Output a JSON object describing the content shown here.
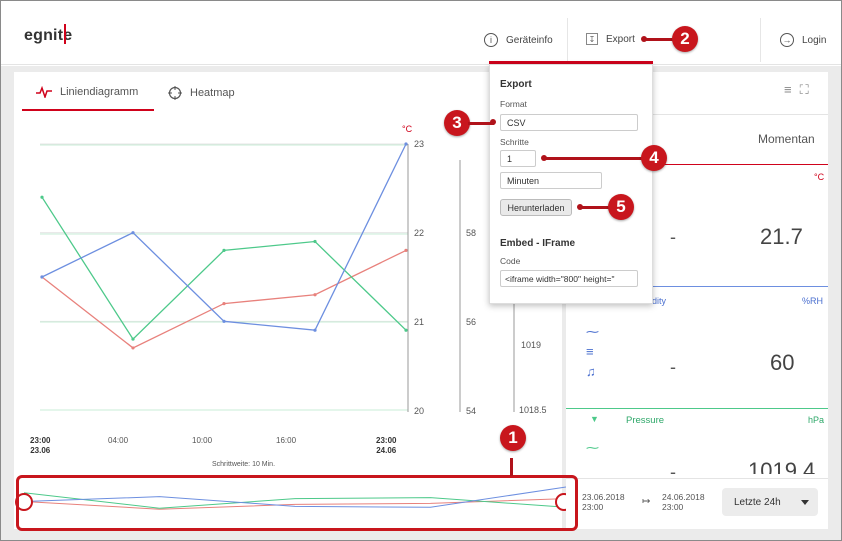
{
  "header": {
    "logo": "egnite",
    "device_info": "Geräteinfo",
    "export": "Export",
    "login": "Login"
  },
  "tabs": [
    {
      "label": "Liniendiagramm",
      "active": true
    },
    {
      "label": "Heatmap",
      "active": false
    }
  ],
  "chart": {
    "unit_left": "°C",
    "y_ticks_temp": [
      "23",
      "22",
      "21",
      "20"
    ],
    "y_ticks_hum": [
      "58",
      "56",
      "54"
    ],
    "y_ticks_pressure": [
      "1019",
      "1018.5"
    ],
    "x_ticks": [
      {
        "time": "23:00",
        "date": "23.06"
      },
      {
        "time": "04:00",
        "date": ""
      },
      {
        "time": "10:00",
        "date": ""
      },
      {
        "time": "16:00",
        "date": ""
      },
      {
        "time": "23:00",
        "date": "24.06"
      }
    ],
    "step_width": "Schrittweite: 10 Min."
  },
  "chart_data": {
    "type": "line",
    "x": [
      "23:00",
      "04:00",
      "10:00",
      "16:00",
      "23:00"
    ],
    "series": [
      {
        "values": [
          21.5,
          20.7,
          21.2,
          21.3,
          21.8
        ]
      },
      {
        "values": [
          22.4,
          20.8,
          21.8,
          21.9,
          20.9
        ]
      },
      {
        "values": [
          21.5,
          22.0,
          21.0,
          20.9,
          23.0
        ]
      }
    ],
    "ylim": [
      20,
      23
    ]
  },
  "measurements": {
    "header": "Momentan",
    "temperature": {
      "unit": "°C",
      "value": "21.7",
      "min": "-"
    },
    "humidity": {
      "label": "dity",
      "unit": "%RH",
      "value": "60",
      "min": "-"
    },
    "pressure": {
      "label": "Pressure",
      "unit": "hPa",
      "value": "1019.4",
      "min": "-"
    }
  },
  "date_range": {
    "from_date": "23.06.2018",
    "from_time": "23:00",
    "arrow": "↦",
    "to_date": "24.06.2018",
    "to_time": "23:00",
    "preset": "Letzte 24h"
  },
  "export_panel": {
    "title": "Export",
    "format_label": "Format",
    "format_value": "CSV",
    "steps_label": "Schritte",
    "steps_value": "1",
    "unit_value": "Minuten",
    "download_button": "Herunterladen",
    "embed_title": "Embed - IFrame",
    "code_label": "Code",
    "code_value": "<iframe width=\"800\" height=\""
  },
  "callouts": [
    "1",
    "2",
    "3",
    "4",
    "5"
  ],
  "colors": {
    "accent": "#d0021b",
    "callout": "#c8161d",
    "temperature": "#e8817c",
    "humidity": "#4dc98a",
    "pressure": "#6d8fe0"
  }
}
